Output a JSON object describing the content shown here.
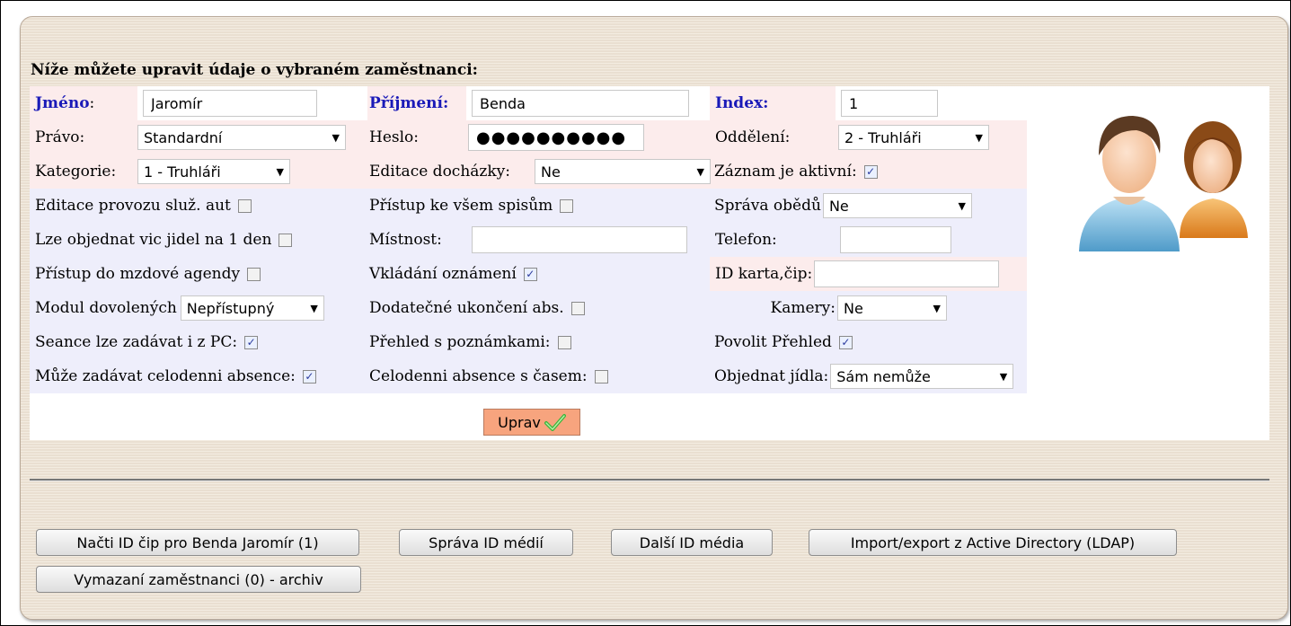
{
  "heading": "Níže můžete upravit údaje o vybraném zaměstnanci:",
  "rows": {
    "r1": {
      "jmeno_label": "Jméno",
      "jmeno_colon": ":",
      "jmeno_value": "Jaromír",
      "prijmeni_label": "Příjmení:",
      "prijmeni_value": "Benda",
      "index_label": "Index:",
      "index_value": "1"
    },
    "r2": {
      "pravo_label": "Právo:",
      "pravo_value": "Standardní",
      "heslo_label": "Heslo:",
      "heslo_value": "●●●●●●●●●●",
      "oddeleni_label": "Oddělení:",
      "oddeleni_value": "2 - Truhláři"
    },
    "r3": {
      "kategorie_label": "Kategorie:",
      "kategorie_value": "1 - Truhláři",
      "editace_dochazky_label": "Editace docházky:",
      "editace_dochazky_value": "Ne",
      "zaznam_label": "Záznam je aktivní:"
    },
    "r4": {
      "editace_provozu_label": "Editace provozu služ. aut",
      "pristup_spisum_label": "Přístup ke všem spisům",
      "sprava_obedu_label": "Správa obědů",
      "sprava_obedu_value": "Ne"
    },
    "r5": {
      "vic_jidel_label": "Lze objednat vic jidel na 1 den",
      "mistnost_label": "Místnost:",
      "mistnost_value": "",
      "telefon_label": "Telefon:",
      "telefon_value": ""
    },
    "r6": {
      "mzdove_label": "Přístup do mzdové agendy",
      "vkladani_label": "Vkládání oznámení",
      "id_karta_label": "ID karta,čip:",
      "id_karta_value": ""
    },
    "r7": {
      "modul_dovolenych_label": "Modul dovolených",
      "modul_dovolenych_value": "Nepřístupný",
      "dodatecne_label": "Dodatečné ukončení abs.",
      "kamery_label": "Kamery:",
      "kamery_value": "Ne"
    },
    "r8": {
      "seance_label": "Seance lze zadávat i z PC:",
      "prehled_poznamky_label": "Přehled s poznámkami:",
      "povolit_prehled_label": "Povolit Přehled"
    },
    "r9": {
      "celodenni_label": "Může zadávat celodenni absence:",
      "celodenni_cas_label": "Celodenni absence s časem:",
      "objednat_label": "Objednat jídla:",
      "objednat_value": "Sám nemůže"
    }
  },
  "checkboxes": {
    "zaznam_aktivni": true,
    "editace_provozu": false,
    "pristup_spisum": false,
    "vic_jidel": false,
    "mzdove": false,
    "vkladani": true,
    "dodatecne": false,
    "seance": true,
    "prehled_poznamky": false,
    "povolit_prehled": true,
    "celodenni": true,
    "celodenni_cas": false
  },
  "check_glyph": "✓",
  "uprav_label": "Uprav",
  "buttons": {
    "nacti": "Načti ID čip pro Benda Jaromír (1)",
    "sprava_id": "Správa ID médií",
    "dalsi_id": "Další ID média",
    "import_export": "Import/export z Active Directory (LDAP)",
    "vymazani": "Vymazaní zaměstnanci (0) - archiv"
  },
  "icons": {
    "users": "users-icon",
    "check": "green-check-icon",
    "dropdown": "chevron-down-icon"
  },
  "colors": {
    "label_blue": "#1a1ab8",
    "row_pink": "#fcecec",
    "row_blue": "#eeeefb",
    "uprav_button": "#f7a47e",
    "panel": "#efe4d6"
  }
}
